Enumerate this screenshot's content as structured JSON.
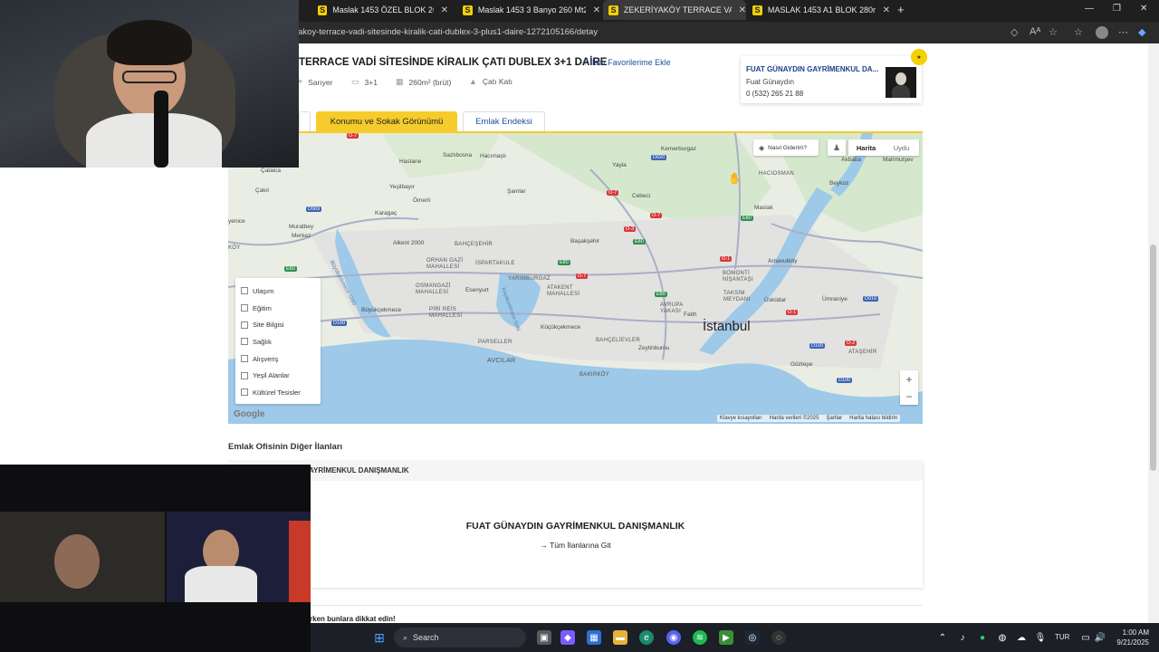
{
  "browser": {
    "tabs": [
      {
        "favicon": "S",
        "label": "Maslak 1453 ÖZEL BLOK 260 M2",
        "active": false
      },
      {
        "favicon": "S",
        "label": "Maslak 1453 3 Banyo 260 Mt2 Ba",
        "active": false
      },
      {
        "favicon": "S",
        "label": "ZEKERİYAKÖY TERRACE VADİ SİTE",
        "active": true
      },
      {
        "favicon": "S",
        "label": "MASLAK 1453 A1 BLOK 280m2 E",
        "active": false
      }
    ],
    "new_tab": "+",
    "url": "akoy-terrace-vadi-sitesinde-kiralik-cati-dublex-3-plus1-daire-1272105166/detay"
  },
  "listing": {
    "title": "TERRACE VADİ SİTESİNDE KİRALIK ÇATI DUBLEX 3+1 DAİRE",
    "favorite_link": "İlanı Favorilerime Ekle",
    "meta": {
      "district": "Sarıyer",
      "rooms": "3+1",
      "area": "260m² (brüt)",
      "floor": "Çatı Katı"
    }
  },
  "agent": {
    "agency": "FUAT GÜNAYDIN GAYRİMENKUL DA...",
    "person": "Fuat Günaydın",
    "phone": "0 (532) 265 21 88"
  },
  "page_tabs": {
    "location": "Konumu ve Sokak Görünümü",
    "endeks": "Emlak Endeksi"
  },
  "map": {
    "route_button": "Nasıl Giderim?",
    "type_map": "Harita",
    "type_satellite": "Uydu",
    "city": "İstanbul",
    "zoom_in": "+",
    "zoom_out": "−",
    "google": "Google",
    "attribution": {
      "shortcuts": "Klavye kısayolları",
      "data": "Harita verileri ©2025",
      "terms": "Şartlar",
      "report": "Harita hatası bildirin"
    },
    "places": {
      "catalca": "Çatalca",
      "cakil": "Çakıl",
      "yenice": "yenice",
      "ktoy": "KÖY",
      "hastane": "Hastane",
      "sazlibosna": "Sazlıbosna",
      "hacimasli": "Hacımaşlı",
      "kemerburgaz": "Kemerburgaz",
      "yayla": "Yayla",
      "hacIosman": "HACIOSMAN",
      "akbaba": "Akbaba",
      "mahmutsevket": "Mahmutşev",
      "yesilbayir": "Yeşilbayır",
      "omerli": "Ömerli",
      "samlar": "Şamlar",
      "cebeci": "Cebeci",
      "beykoz": "Beykoz",
      "maslak": "Maslak",
      "muratbey": "Muratbey",
      "merkez": "Merkez",
      "karacaoglu": "Karagaç",
      "alkent": "Alkent 2000",
      "bahcesehir": "BAHÇEŞEHİR",
      "basaksehir": "Başakşehir",
      "ispartakule": "İSPARTAKULE",
      "orhangazi": "ORHAN GAZİ MAHALLESİ",
      "arnavutkoy": "Arnavutköy",
      "bomonti": "BOMONTİ NİŞANTAŞI",
      "osmangazi": "OSMANGAZİ MAHALLESİ",
      "esenyurt": "Esenyurt",
      "yarimburgaz": "YARIMBURGAZ",
      "atakent": "ATAKENT MAHALLESİ",
      "taksim": "TAKSİM MEYDANI",
      "uskudar": "Üsküdar",
      "umraniye": "Ümraniye",
      "buyukcekmece": "Büyükçekmece",
      "piriReis": "PİRİ REİS MAHALLESİ",
      "avrupa": "AVRUPA YAKASI",
      "fatih": "Fatih",
      "kucukcekmece": "Küçükçekmece",
      "parseller": "PARSELLER",
      "bahcelievler": "BAHÇELİEVLER",
      "zeytinburnu": "Zeytinburnu",
      "atasehir": "ATAŞEHİR",
      "avcilar": "AVCILAR",
      "bakirkoy": "BAKIRKÖY",
      "goztepe": "Göztepe",
      "buyukcekmeceGolu": "Büyükçekmece Gölü",
      "kucukcekmeceGolu": "Küçükçekmece Gölü"
    },
    "roads": [
      "O-7",
      "D020",
      "O-7",
      "O-7",
      "D569",
      "E80",
      "O-3",
      "O-7",
      "E80",
      "E80",
      "D100",
      "O-1",
      "O-1",
      "D016",
      "O-2",
      "D100",
      "D100",
      "E80",
      "E80"
    ],
    "layers": [
      "Ulaşım",
      "Eğitim",
      "Site Bilgisi",
      "Sağlık",
      "Alışveriş",
      "Yeşil Alanlar",
      "Kültürel Tesisler"
    ]
  },
  "office": {
    "heading": "Emlak Ofisinin Diğer İlanları",
    "bar_label": "AYRİMENKUL DANIŞMANLIK",
    "name": "FUAT GÜNAYDIN GAYRİMENKUL DANIŞMANLIK",
    "all_listings": "Tüm İlanlarına Git"
  },
  "warning": "rken bunlara dikkat edin!",
  "taskbar": {
    "search": "Search",
    "lang": "TUR",
    "time": "1:00 AM",
    "date": "9/21/2025"
  },
  "colors": {
    "accent_yellow": "#f5cc2b",
    "link_blue": "#1e4e9c"
  }
}
